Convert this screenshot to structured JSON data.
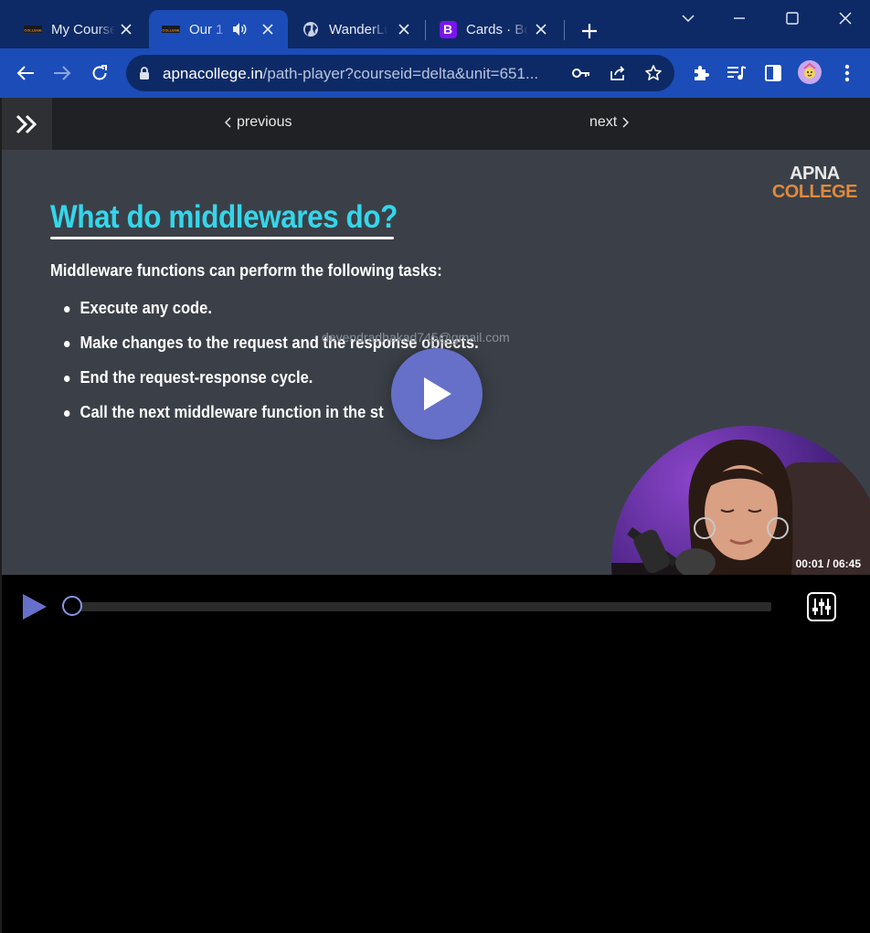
{
  "colors": {
    "titlebar_bg": "#0e2a66",
    "toolbar_bg": "#1b4cb8",
    "accent": "#6670c8",
    "slide_bg": "#3b4048",
    "slide_title": "#34d6ea",
    "brand_orange": "#e08a3c"
  },
  "tabs": [
    {
      "title": "My Courses",
      "icon": "apna-college-favicon",
      "active": false
    },
    {
      "title": "Our 1",
      "icon": "apna-college-favicon",
      "active": true,
      "audio": true
    },
    {
      "title": "WanderLust",
      "icon": "globe-icon",
      "active": false
    },
    {
      "title": "Cards · Bootstrap",
      "icon": "bootstrap-icon",
      "active": false
    }
  ],
  "tab_favicon_text": "COLLEGE",
  "bootstrap_letter": "B",
  "address": {
    "domain": "apnacollege.in",
    "path": "/path-player?courseid=delta&unit=651..."
  },
  "nav": {
    "previous": "previous",
    "next": "next"
  },
  "brand": {
    "line1": "APNA",
    "line2": "COLLEGE"
  },
  "slide": {
    "title": "What do middlewares do?",
    "intro": "Middleware functions can perform the following tasks:",
    "bullets": [
      "Execute any code.",
      "Make changes to the request and the response objects.",
      "End the request-response cycle.",
      "Call the next middleware function in the st"
    ],
    "watermark": "devendradhakad745@gmail.com"
  },
  "player": {
    "time": "00:01 / 06:45",
    "progress_fraction": 0.0026
  }
}
